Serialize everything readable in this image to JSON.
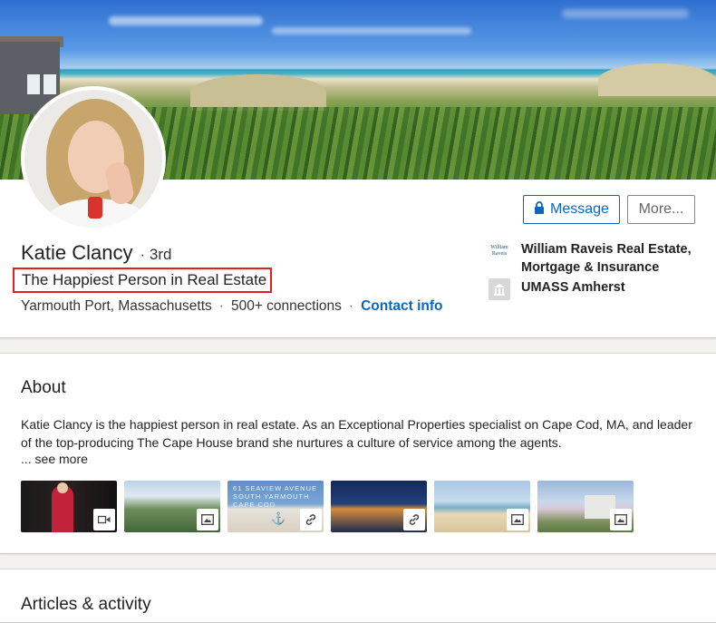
{
  "profile": {
    "name": "Katie Clancy",
    "degree": "· 3rd",
    "headline": "The Happiest Person in Real Estate",
    "location": "Yarmouth Port, Massachusetts",
    "connections": "500+ connections",
    "contact_info": "Contact info",
    "separator": "·"
  },
  "actions": {
    "message": "Message",
    "more": "More..."
  },
  "experience": [
    {
      "name": "William Raveis Real Estate, Mortgage & Insurance",
      "logo_text": "William Raveis"
    },
    {
      "name": "UMASS Amherst"
    }
  ],
  "about": {
    "title": "About",
    "text": "Katie Clancy is the happiest person in real estate. As an Exceptional Properties specialist on Cape Cod, MA, and leader of the top-producing The Cape House brand she nurtures a culture of service among the agents.",
    "see_more": "... see more",
    "media": [
      {
        "type": "video",
        "icon": "video-icon"
      },
      {
        "type": "image",
        "icon": "image-icon"
      },
      {
        "type": "link",
        "icon": "link-icon",
        "text": "61 SEAVIEW AVENUE SOUTH YARMOUTH CAPE COD"
      },
      {
        "type": "link",
        "icon": "link-icon"
      },
      {
        "type": "image",
        "icon": "image-icon"
      },
      {
        "type": "image",
        "icon": "image-icon"
      }
    ]
  },
  "articles": {
    "title": "Articles & activity"
  },
  "colors": {
    "accent": "#0a66c2",
    "highlight_box": "#e4201e"
  }
}
